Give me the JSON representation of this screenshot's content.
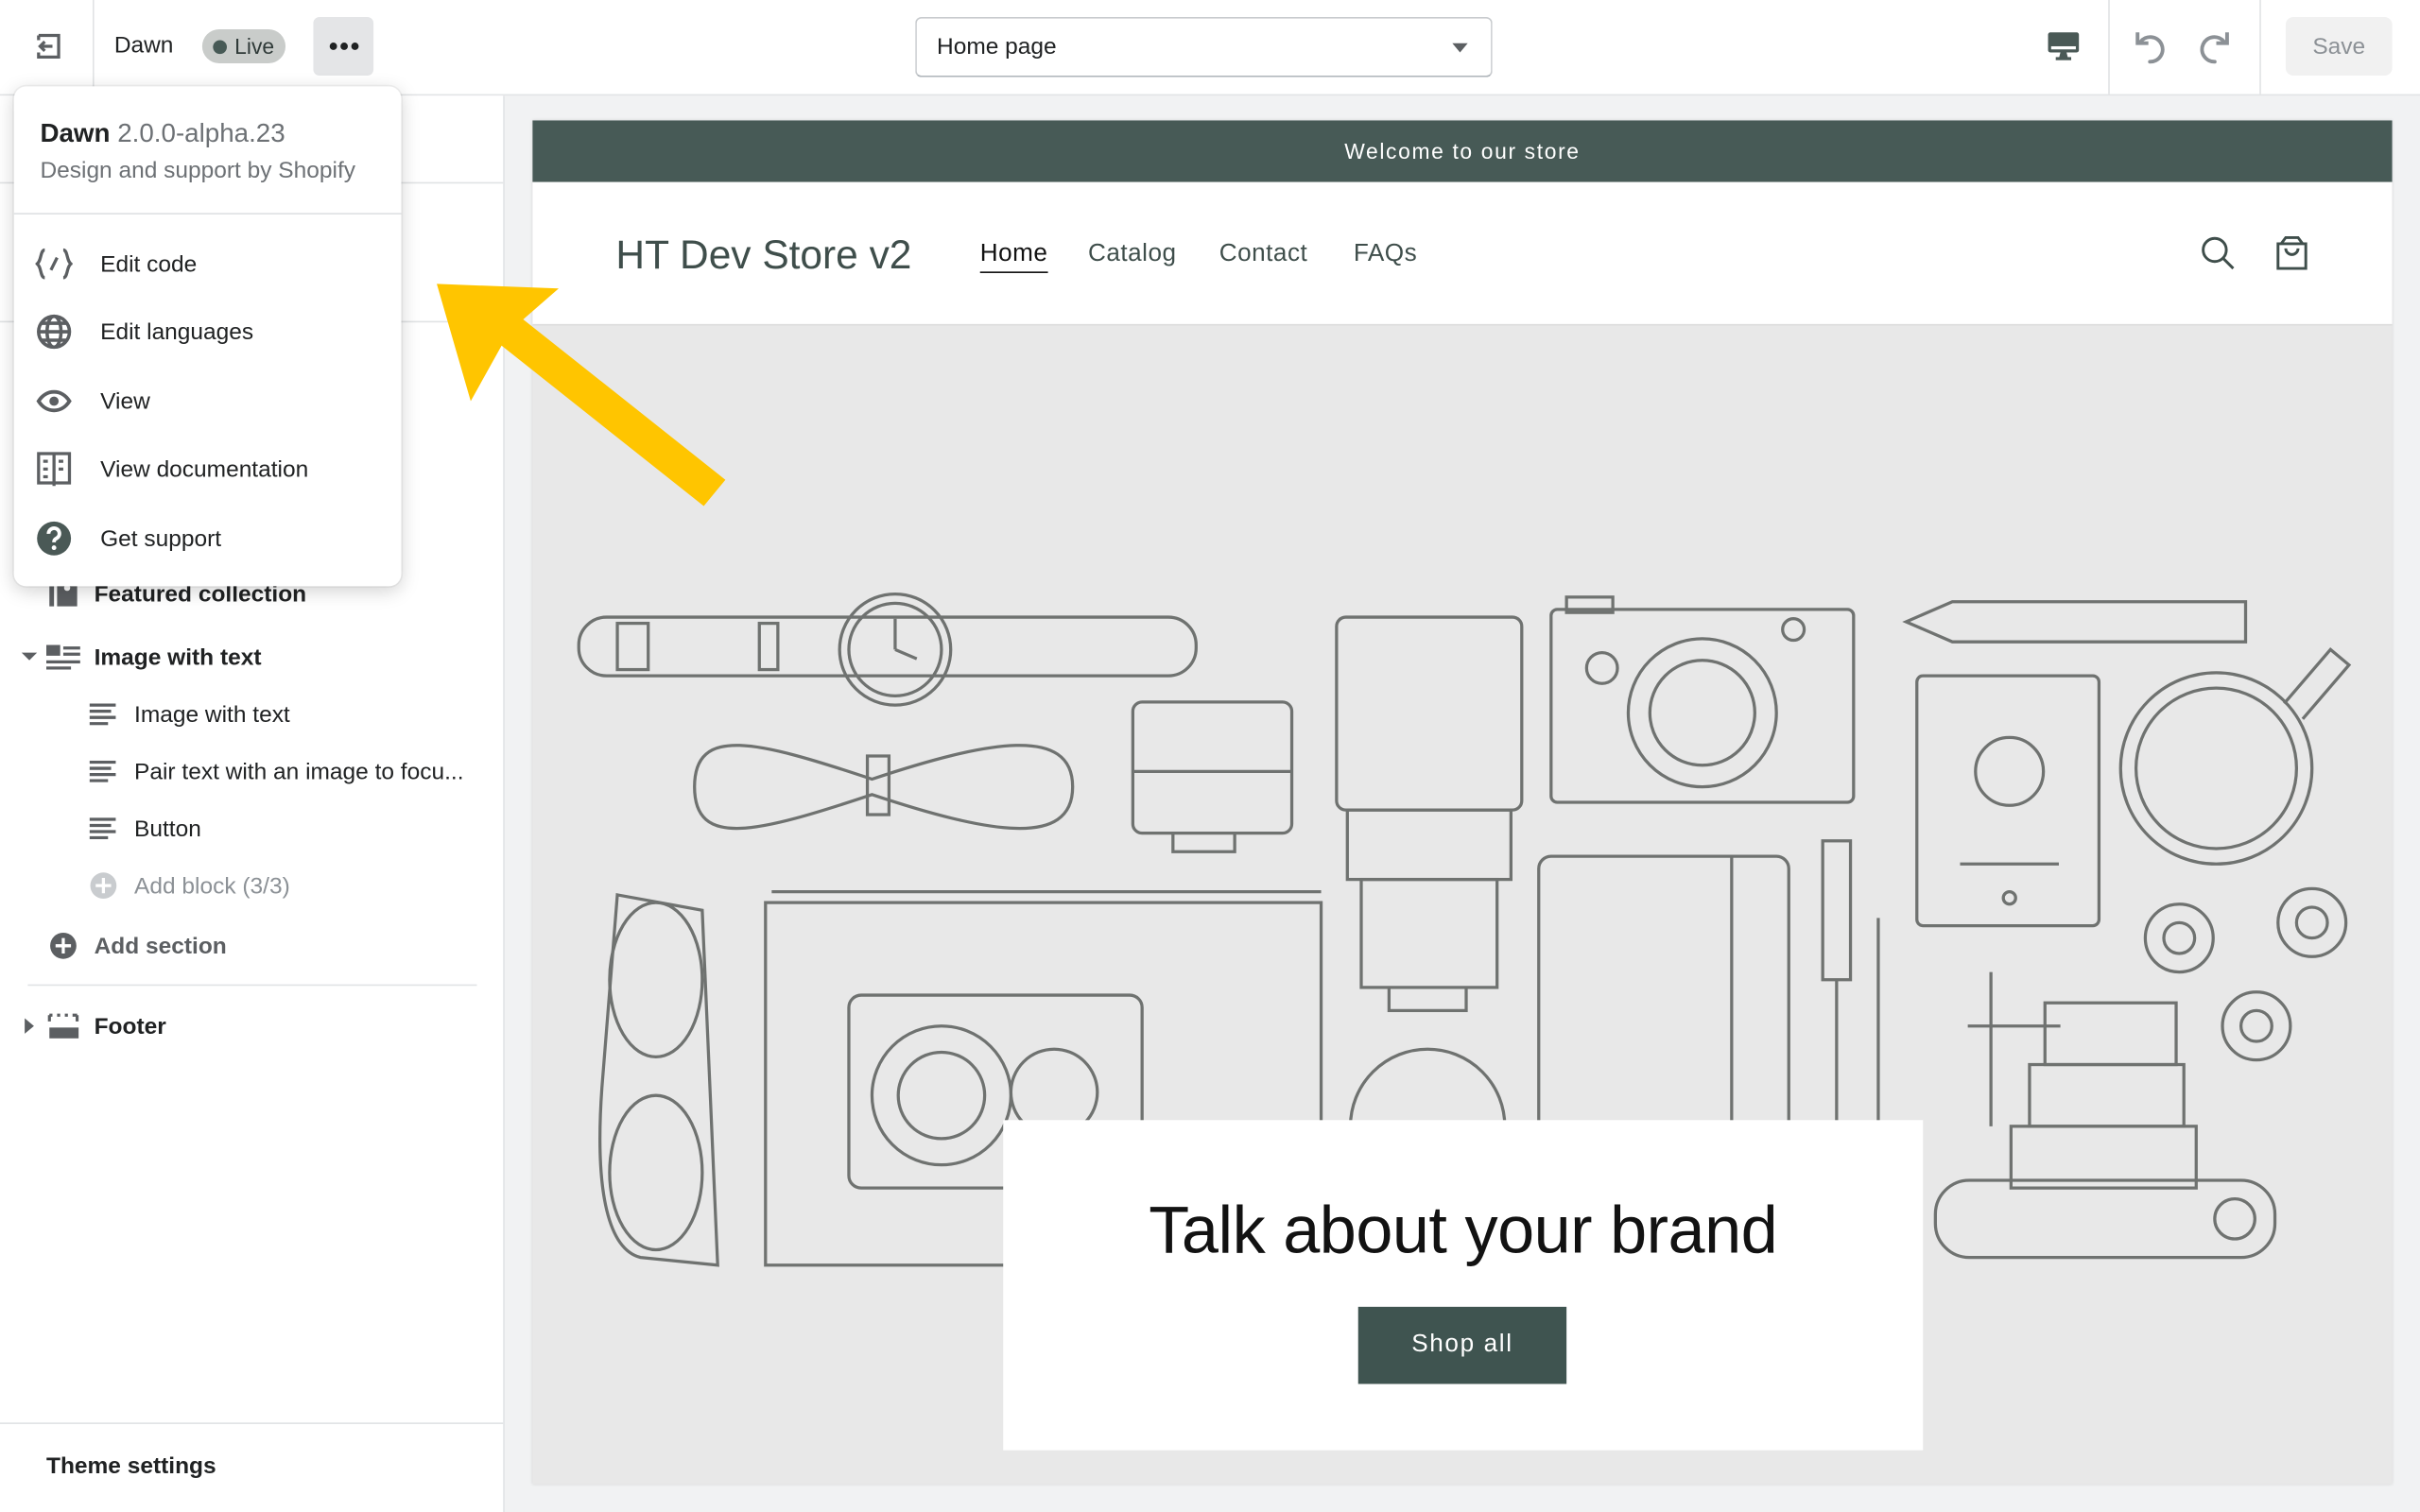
{
  "topbar": {
    "theme_name": "Dawn",
    "status_badge": "Live",
    "page_select": "Home page",
    "save_label": "Save",
    "icons": [
      "exit-icon",
      "more-horizontal-icon",
      "chevron-down-icon",
      "desktop-icon",
      "undo-icon",
      "redo-icon"
    ]
  },
  "menu": {
    "theme_name": "Dawn",
    "version": "2.0.0-alpha.23",
    "subtitle": "Design and support by Shopify",
    "items": [
      {
        "label": "Edit code",
        "icon": "code-icon"
      },
      {
        "label": "Edit languages",
        "icon": "globe-icon"
      },
      {
        "label": "View",
        "icon": "eye-icon"
      },
      {
        "label": "View documentation",
        "icon": "book-icon"
      },
      {
        "label": "Get support",
        "icon": "question-icon"
      }
    ]
  },
  "sidebar": {
    "sections": [
      {
        "label": "Featured collection",
        "icon": "collection-icon"
      },
      {
        "label": "Image with text",
        "icon": "image-text-icon",
        "expanded": true,
        "blocks": [
          "Image with text",
          "Pair text with an image to focu...",
          "Button"
        ]
      }
    ],
    "add_block": "Add block (3/3)",
    "add_section": "Add section",
    "footer": "Footer",
    "theme_settings": "Theme settings"
  },
  "store": {
    "announcement": "Welcome to our store",
    "store_name": "HT Dev Store v2",
    "nav": [
      "Home",
      "Catalog",
      "Contact",
      "FAQs"
    ],
    "active_nav": "Home",
    "heading": "Talk about your brand",
    "button": "Shop all",
    "colors": {
      "brand": "#475a56",
      "button": "#3f5450",
      "hero_bg": "#e8e8e8"
    }
  },
  "annotation": {
    "color": "#ffc500",
    "icon": "arrow-annotation"
  }
}
